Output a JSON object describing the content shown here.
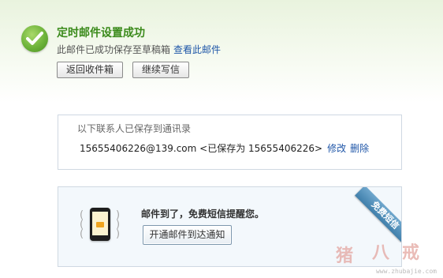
{
  "header": {
    "title": "定时邮件设置成功",
    "subtitle": "此邮件已成功保存至草稿箱",
    "view_link": "查看此邮件"
  },
  "buttons": {
    "back_inbox": "返回收件箱",
    "continue_write": "继续写信"
  },
  "contacts": {
    "title": "以下联系人已保存到通讯录",
    "entry": "15655406226@139.com <已保存为 15655406226>",
    "edit_link": "修改",
    "delete_link": "删除"
  },
  "sms_promo": {
    "text": "邮件到了，免费短信提醒您。",
    "button": "开通邮件到达通知",
    "ribbon": "免费短信"
  },
  "watermark": {
    "chars": [
      "猪",
      "八",
      "戒"
    ],
    "url": "www.zhubajie.com"
  },
  "colors": {
    "success_green": "#3a8a1a",
    "link_blue": "#1f56a8",
    "ribbon_blue": "#4f8fbd"
  },
  "icons": {
    "success": "check-circle-icon",
    "phone": "phone-mail-icon"
  }
}
